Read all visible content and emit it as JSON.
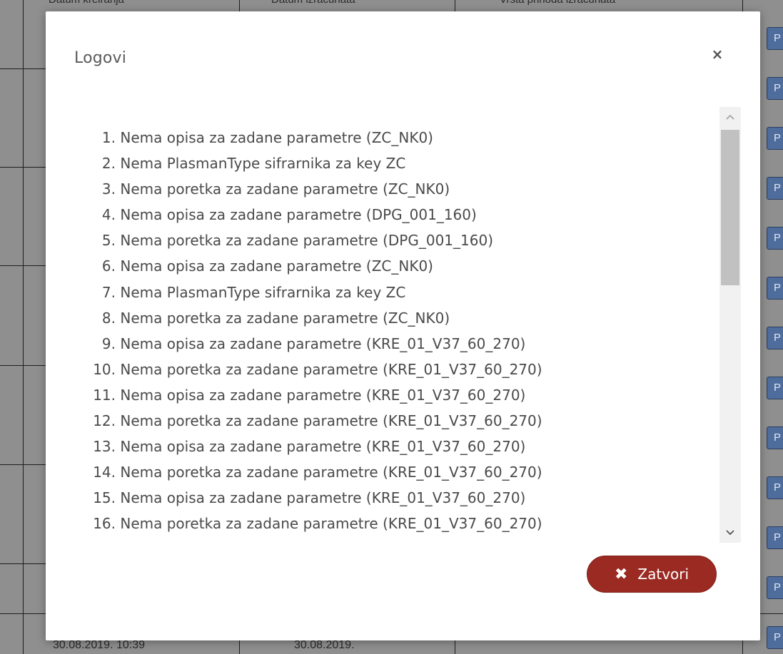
{
  "background": {
    "header": {
      "col1": "Datum kreiranja",
      "col2": "Datum izračunata",
      "col3": "Vrsta prihoda izračunata"
    },
    "footer": {
      "col1": "30.08.2019. 10:39",
      "col2": "30.08.2019."
    },
    "row_button_label": "P"
  },
  "modal": {
    "title": "Logovi",
    "close_icon": "×",
    "logs": [
      {
        "num": "1.",
        "text": "Nema opisa za zadane parametre (ZC_NK0)"
      },
      {
        "num": "2.",
        "text": "Nema PlasmanType sifrarnika za key ZC"
      },
      {
        "num": "3.",
        "text": "Nema poretka za zadane parametre (ZC_NK0)"
      },
      {
        "num": "4.",
        "text": "Nema opisa za zadane parametre (DPG_001_160)"
      },
      {
        "num": "5.",
        "text": "Nema poretka za zadane parametre (DPG_001_160)"
      },
      {
        "num": "6.",
        "text": "Nema opisa za zadane parametre (ZC_NK0)"
      },
      {
        "num": "7.",
        "text": "Nema PlasmanType sifrarnika za key ZC"
      },
      {
        "num": "8.",
        "text": "Nema poretka za zadane parametre (ZC_NK0)"
      },
      {
        "num": "9.",
        "text": "Nema opisa za zadane parametre (KRE_01_V37_60_270)"
      },
      {
        "num": "10.",
        "text": "Nema poretka za zadane parametre (KRE_01_V37_60_270)"
      },
      {
        "num": "11.",
        "text": "Nema opisa za zadane parametre (KRE_01_V37_60_270)"
      },
      {
        "num": "12.",
        "text": "Nema poretka za zadane parametre (KRE_01_V37_60_270)"
      },
      {
        "num": "13.",
        "text": "Nema opisa za zadane parametre (KRE_01_V37_60_270)"
      },
      {
        "num": "14.",
        "text": "Nema poretka za zadane parametre (KRE_01_V37_60_270)"
      },
      {
        "num": "15.",
        "text": "Nema opisa za zadane parametre (KRE_01_V37_60_270)"
      },
      {
        "num": "16.",
        "text": "Nema poretka za zadane parametre (KRE_01_V37_60_270)"
      }
    ],
    "close_button": {
      "icon": "✖",
      "label": "Zatvori"
    }
  },
  "colors": {
    "overlay": "#8f8f8f",
    "close_button_bg": "#9b2a22",
    "row_button_bg": "#4e6c9c",
    "title_text": "#5a5a5a"
  }
}
